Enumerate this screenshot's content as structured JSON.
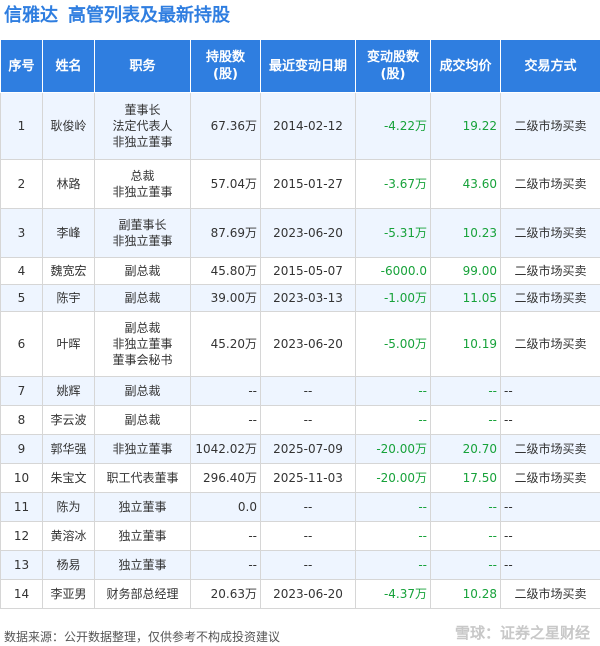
{
  "header": {
    "company": "信雅达",
    "subtitle": "高管列表及最新持股"
  },
  "columns": [
    "序号",
    "姓名",
    "职务",
    "持股数\n(股)",
    "最近变动日期",
    "变动股数\n(股)",
    "成交均价",
    "交易方式"
  ],
  "rows": [
    {
      "no": "1",
      "name": "耿俊岭",
      "role": [
        "董事长",
        "法定代表人",
        "非独立董事"
      ],
      "shares": "67.36万",
      "date": "2014-02-12",
      "change": "-4.22万",
      "price": "19.22",
      "method": "二级市场买卖"
    },
    {
      "no": "2",
      "name": "林路",
      "role": [
        "总裁",
        "非独立董事"
      ],
      "shares": "57.04万",
      "date": "2015-01-27",
      "change": "-3.67万",
      "price": "43.60",
      "method": "二级市场买卖"
    },
    {
      "no": "3",
      "name": "李峰",
      "role": [
        "副董事长",
        "非独立董事"
      ],
      "shares": "87.69万",
      "date": "2023-06-20",
      "change": "-5.31万",
      "price": "10.23",
      "method": "二级市场买卖"
    },
    {
      "no": "4",
      "name": "魏宽宏",
      "role": [
        "副总裁"
      ],
      "shares": "45.80万",
      "date": "2015-05-07",
      "change": "-6000.0",
      "price": "99.00",
      "method": "二级市场买卖"
    },
    {
      "no": "5",
      "name": "陈宇",
      "role": [
        "副总裁"
      ],
      "shares": "39.00万",
      "date": "2023-03-13",
      "change": "-1.00万",
      "price": "11.05",
      "method": "二级市场买卖"
    },
    {
      "no": "6",
      "name": "叶晖",
      "role": [
        "副总裁",
        "非独立董事",
        "董事会秘书"
      ],
      "shares": "45.20万",
      "date": "2023-06-20",
      "change": "-5.00万",
      "price": "10.19",
      "method": "二级市场买卖"
    },
    {
      "no": "7",
      "name": "姚辉",
      "role": [
        "副总裁"
      ],
      "shares": "--",
      "date": "--",
      "change": "--",
      "price": "--",
      "method": "--"
    },
    {
      "no": "8",
      "name": "李云波",
      "role": [
        "副总裁"
      ],
      "shares": "--",
      "date": "--",
      "change": "--",
      "price": "--",
      "method": "--"
    },
    {
      "no": "9",
      "name": "郭华强",
      "role": [
        "非独立董事"
      ],
      "shares": "1042.02万",
      "date": "2025-07-09",
      "change": "-20.00万",
      "price": "20.70",
      "method": "二级市场买卖"
    },
    {
      "no": "10",
      "name": "朱宝文",
      "role": [
        "职工代表董事"
      ],
      "shares": "296.40万",
      "date": "2025-11-03",
      "change": "-20.00万",
      "price": "17.50",
      "method": "二级市场买卖"
    },
    {
      "no": "11",
      "name": "陈为",
      "role": [
        "独立董事"
      ],
      "shares": "0.0",
      "date": "--",
      "change": "--",
      "price": "--",
      "method": "--"
    },
    {
      "no": "12",
      "name": "黄溶冰",
      "role": [
        "独立董事"
      ],
      "shares": "--",
      "date": "--",
      "change": "--",
      "price": "--",
      "method": "--"
    },
    {
      "no": "13",
      "name": "杨易",
      "role": [
        "独立董事"
      ],
      "shares": "--",
      "date": "--",
      "change": "--",
      "price": "--",
      "method": "--"
    },
    {
      "no": "14",
      "name": "李亚男",
      "role": [
        "财务部总经理"
      ],
      "shares": "20.63万",
      "date": "2023-06-20",
      "change": "-4.37万",
      "price": "10.28",
      "method": "二级市场买卖"
    }
  ],
  "footer": {
    "source": "数据来源：公开数据整理，仅供参考不构成投资建议",
    "brand": "雪球：证券之星财经",
    "watermark": "证券之星"
  },
  "colors": {
    "accent": "#2f7ee0",
    "change": "#17a23a",
    "row_alt": "#eef5ff"
  }
}
